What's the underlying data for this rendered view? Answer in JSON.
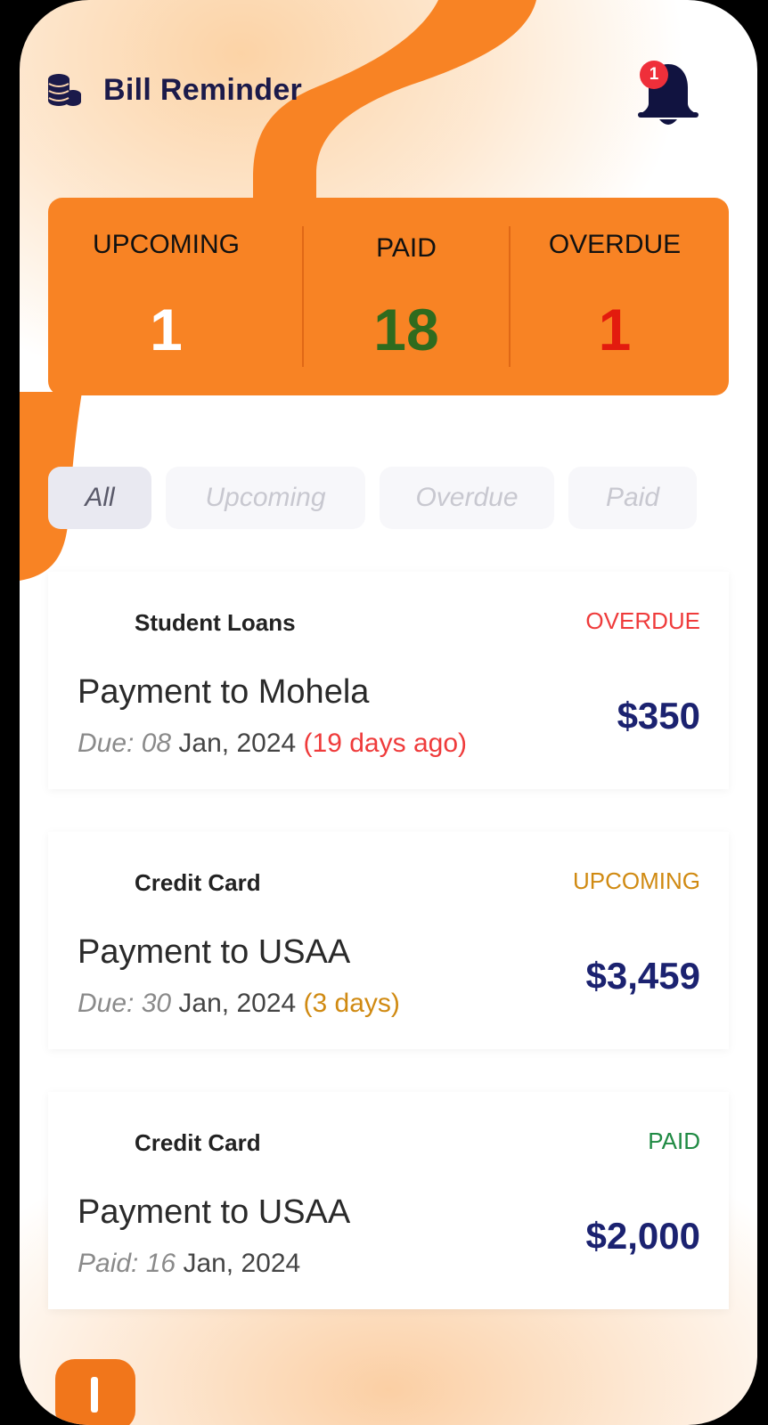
{
  "header": {
    "title": "Bill Reminder",
    "notification_count": "1"
  },
  "summary": {
    "upcoming_label": "UPCOMING",
    "upcoming_value": "1",
    "paid_label": "PAID",
    "paid_value": "18",
    "overdue_label": "OVERDUE",
    "overdue_value": "1"
  },
  "filters": [
    "All",
    "Upcoming",
    "Overdue",
    "Paid"
  ],
  "bills": [
    {
      "category": "Student Loans",
      "status": "OVERDUE",
      "payee": "Payment to Mohela",
      "date_prefix": "Due: 08",
      "date_rest": "Jan, 2024",
      "relative": "(19 days ago)",
      "amount": "$350"
    },
    {
      "category": "Credit Card",
      "status": "UPCOMING",
      "payee": "Payment to USAA",
      "date_prefix": "Due: 30",
      "date_rest": "Jan, 2024",
      "relative": "(3 days)",
      "amount": "$3,459"
    },
    {
      "category": "Credit Card",
      "status": "PAID",
      "payee": "Payment to USAA",
      "date_prefix": "Paid: 16",
      "date_rest": "Jan, 2024",
      "relative": "",
      "amount": "$2,000"
    }
  ],
  "colors": {
    "accent": "#f88324",
    "overdue": "#ef3b3b",
    "upcoming": "#d08a12",
    "paid": "#1f8a43",
    "amount": "#1b2270",
    "title": "#1b1a4a"
  },
  "icons": {
    "app": "coins-stack-icon",
    "notifications": "bell-icon",
    "fab": "plus-icon"
  }
}
